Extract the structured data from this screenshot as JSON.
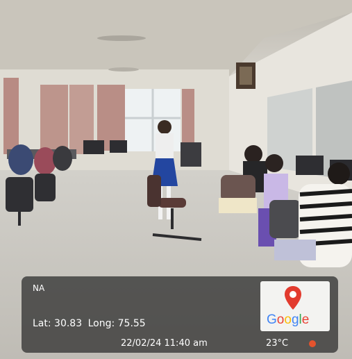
{
  "location": {
    "name": "NA"
  },
  "coordinates": {
    "lat": "Lat: 30.83",
    "long": "Long: 75.55"
  },
  "timestamp": "22/02/24 11:40 am",
  "weather": {
    "temperature": "23°C",
    "icon": "weather-dot-icon"
  },
  "map": {
    "brand": "Google",
    "icon": "map-pin-icon"
  },
  "colors": {
    "accent": "#e23b2e"
  }
}
